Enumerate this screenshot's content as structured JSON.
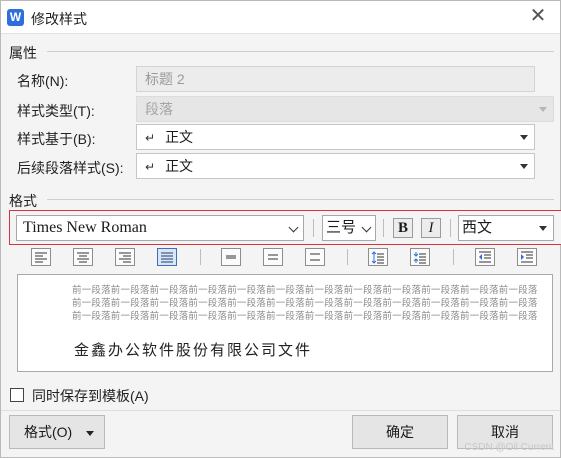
{
  "window": {
    "title": "修改样式",
    "app_icon_letter": "W",
    "close_glyph": "✕"
  },
  "properties": {
    "section_title": "属性",
    "name_label": "名称(N):",
    "name_value": "标题 2",
    "style_type_label": "样式类型(T):",
    "style_type_value": "段落",
    "based_on_label": "样式基于(B):",
    "based_on_value": "正文",
    "following_label": "后续段落样式(S):",
    "following_value": "正文",
    "paragraph_mark": "↵"
  },
  "format": {
    "section_title": "格式",
    "font_name": "Times New Roman",
    "font_size": "三号",
    "bold_label": "B",
    "italic_label": "I",
    "script": "西文",
    "highlight_color": "#d8343f"
  },
  "toolbar_buttons": [
    "align-left-icon",
    "align-center-icon",
    "align-right-icon",
    "justify-icon",
    "line-spacing-single-icon",
    "line-spacing-1-5-icon",
    "line-spacing-double-icon",
    "space-before-increase-icon",
    "space-before-decrease-icon",
    "decrease-indent-icon",
    "increase-indent-icon"
  ],
  "preview": {
    "previous_lines": [
      "前一段落前一段落前一段落前一段落前一段落前一段落前一段落前一段落前一段落前一段落前一段落前一段落",
      "前一段落前一段落前一段落前一段落前一段落前一段落前一段落前一段落前一段落前一段落前一段落前一段落",
      "前一段落前一段落前一段落前一段落前一段落前一段落前一段落前一段落前一段落前一段落前一段落前一段落"
    ],
    "sample_text": "金鑫办公软件股份有限公司文件"
  },
  "options": {
    "save_to_template_label": "同时保存到模板(A)",
    "save_to_template_checked": false
  },
  "buttons": {
    "format_label": "格式(O)",
    "ok_label": "确定",
    "cancel_label": "取消"
  },
  "watermark": "CSDN @Oil Current"
}
